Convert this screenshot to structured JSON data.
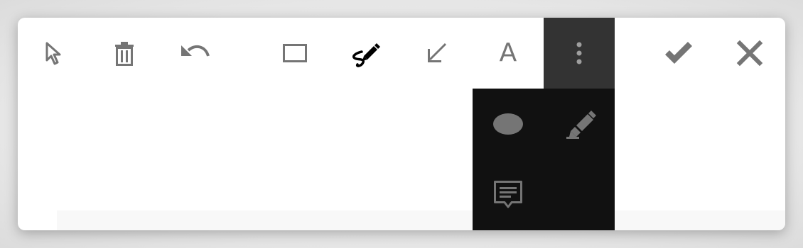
{
  "toolbar": {
    "tools": [
      {
        "name": "select",
        "icon": "cursor-arrow-icon"
      },
      {
        "name": "delete",
        "icon": "trash-icon"
      },
      {
        "name": "undo",
        "icon": "undo-arrow-icon"
      },
      {
        "name": "rectangle",
        "icon": "rectangle-icon"
      },
      {
        "name": "freehand-draw",
        "icon": "freehand-pen-icon",
        "active": true
      },
      {
        "name": "arrow",
        "icon": "diagonal-arrow-icon"
      },
      {
        "name": "text",
        "icon": "letter-a-icon",
        "label": "A"
      },
      {
        "name": "more",
        "icon": "vertical-dots-icon",
        "expanded": true
      },
      {
        "name": "confirm",
        "icon": "checkmark-icon"
      },
      {
        "name": "cancel",
        "icon": "close-x-icon"
      }
    ]
  },
  "more_menu": {
    "items": [
      {
        "name": "ellipse",
        "icon": "ellipse-icon"
      },
      {
        "name": "highlighter",
        "icon": "highlighter-icon"
      },
      {
        "name": "comment",
        "icon": "comment-bubble-icon"
      }
    ]
  },
  "colors": {
    "icon_gray": "#757575",
    "icon_active": "#000000",
    "more_bg": "#333333",
    "menu_bg": "#111111"
  }
}
